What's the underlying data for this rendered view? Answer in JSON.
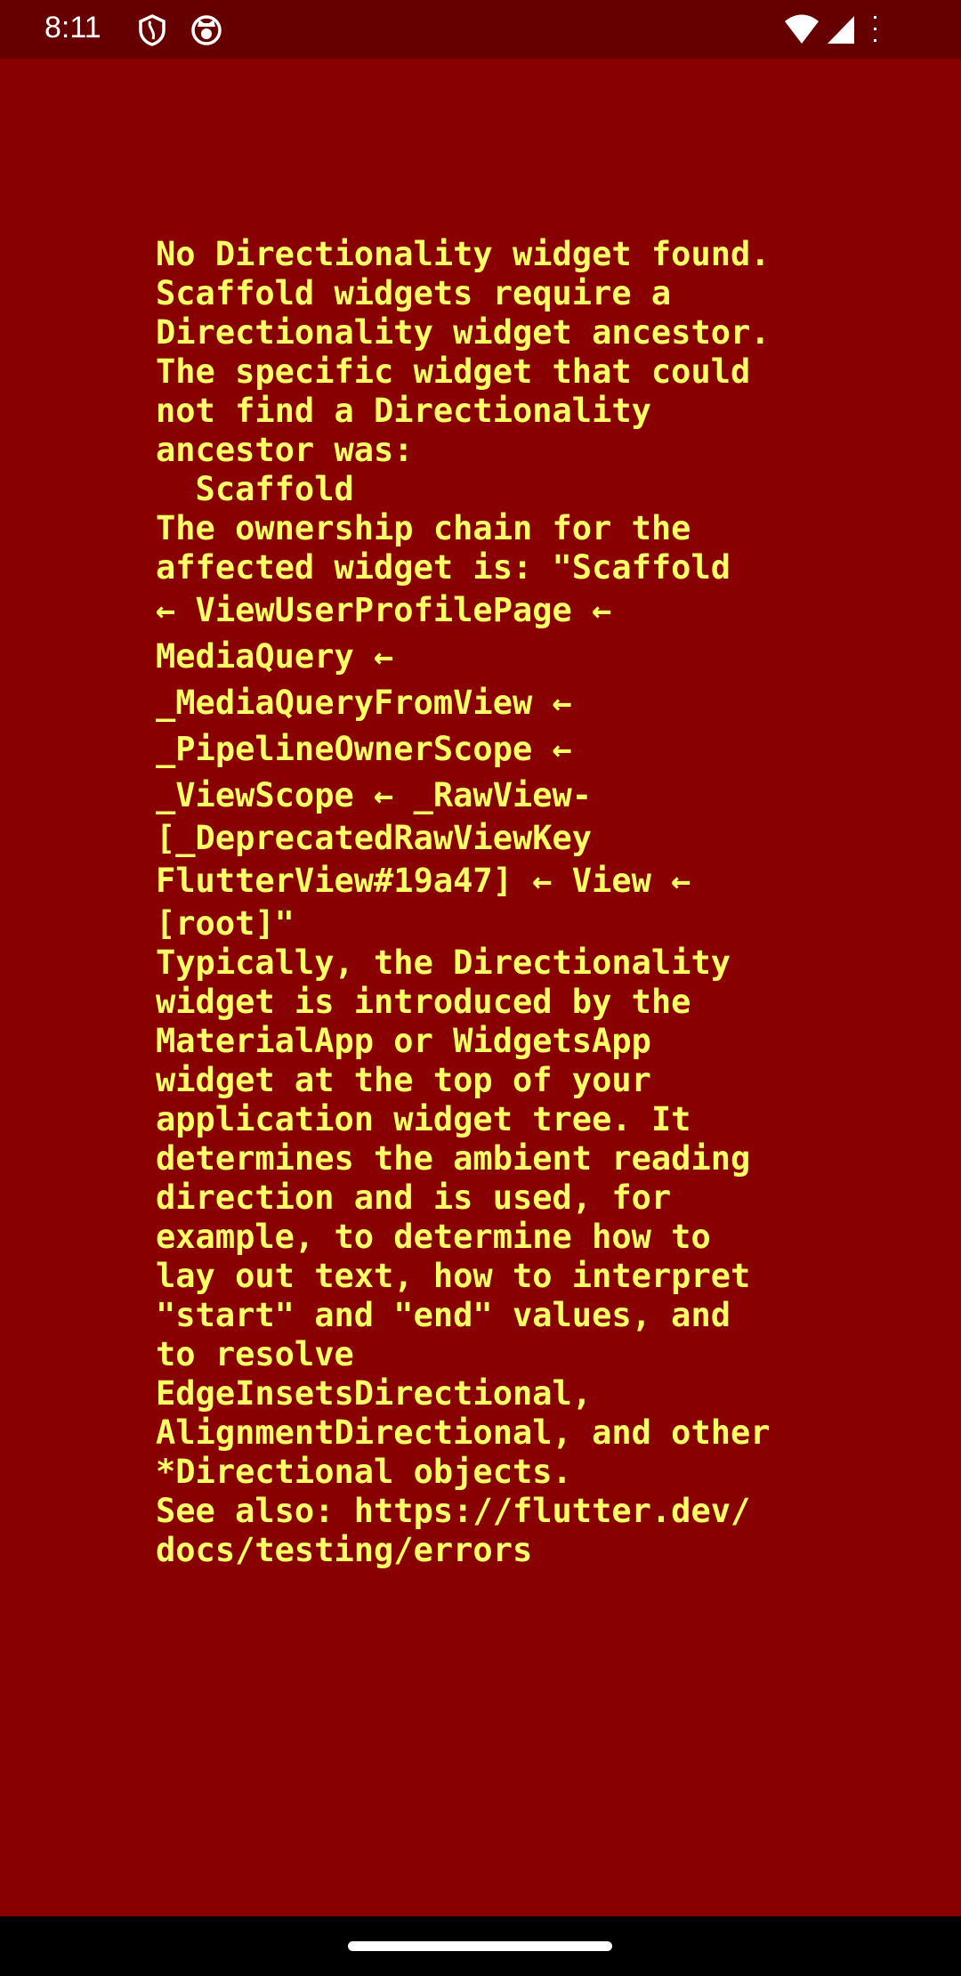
{
  "status_bar": {
    "time": "8:11",
    "icons": [
      "shield-icon",
      "cat-face-icon",
      "wifi-icon",
      "cell-signal-icon"
    ]
  },
  "error": {
    "lines": [
      "No Directionality widget found.",
      "Scaffold widgets require a",
      "Directionality widget ancestor.",
      "The specific widget that could",
      "not find a Directionality",
      "ancestor was:",
      "  Scaffold",
      "The ownership chain for the",
      "affected widget is: \"Scaffold",
      "← ViewUserProfilePage ←",
      "MediaQuery ←",
      "_MediaQueryFromView ←",
      "_PipelineOwnerScope ←",
      "_ViewScope ← _RawView-",
      "[_DeprecatedRawViewKey",
      "FlutterView#19a47] ← View ←",
      "[root]\"",
      "Typically, the Directionality",
      "widget is introduced by the",
      "MaterialApp or WidgetsApp",
      "widget at the top of your",
      "application widget tree. It",
      "determines the ambient reading",
      "direction and is used, for",
      "example, to determine how to",
      "lay out text, how to interpret",
      "\"start\" and \"end\" values, and",
      "to resolve",
      "EdgeInsetsDirectional,",
      "AlignmentDirectional, and other",
      "*Directional objects.",
      "See also: https://flutter.dev/",
      "docs/testing/errors"
    ]
  },
  "colors": {
    "background": "#880000",
    "status_bar": "#660000",
    "text": "#FFFF66"
  }
}
